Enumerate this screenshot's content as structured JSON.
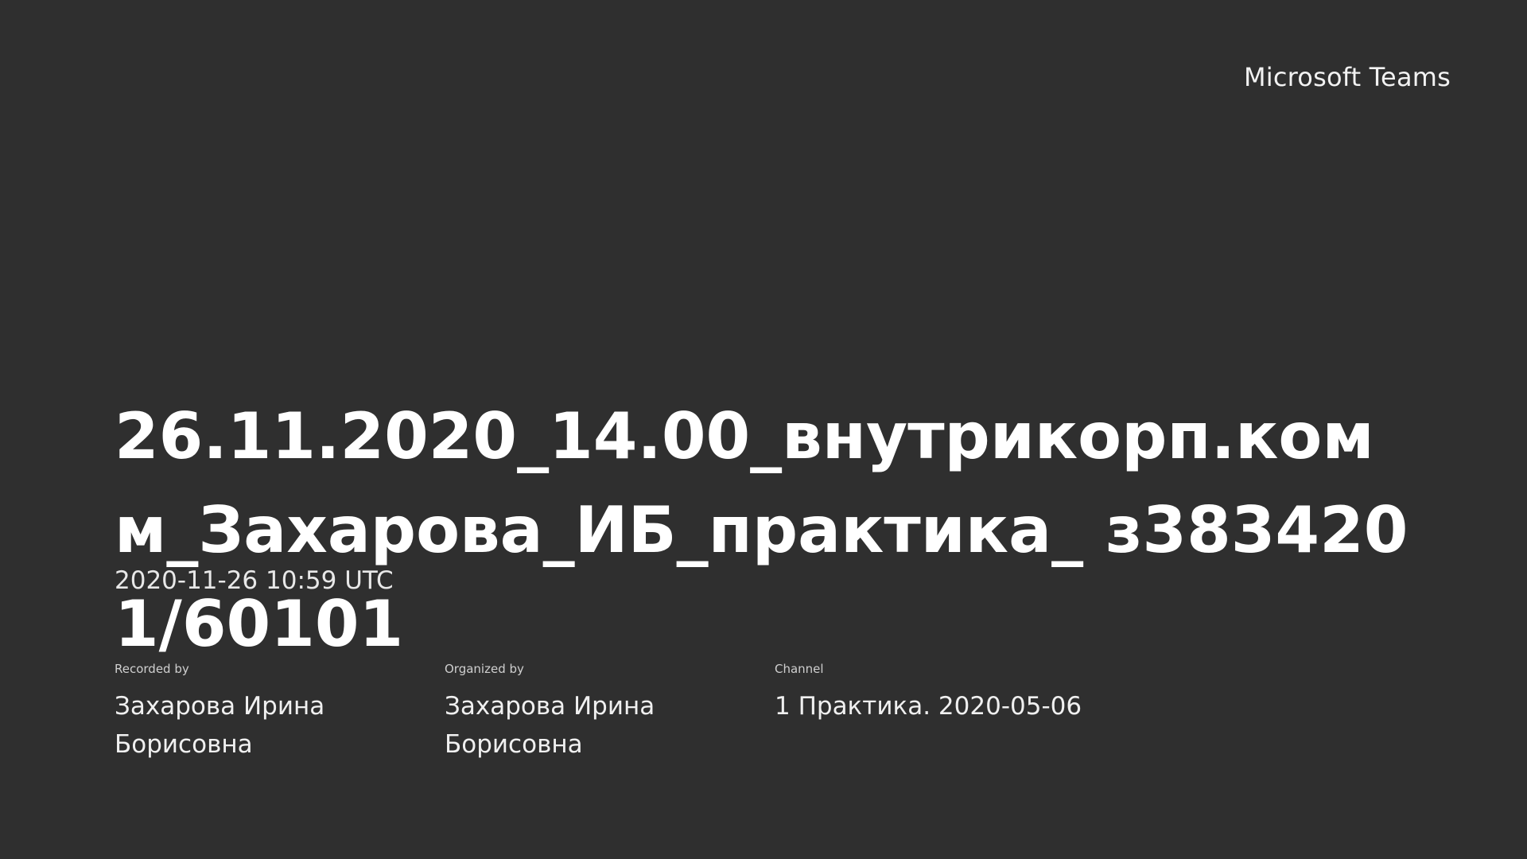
{
  "brand": "Microsoft Teams",
  "recording": {
    "title": "26.11.2020_14.00_внутрикорп.комм_Захарова_ИБ_практика_ з3834201/60101",
    "datetime": "2020-11-26 10:59 UTC"
  },
  "meta": {
    "recorded_by_label": "Recorded by",
    "recorded_by": "Захарова Ирина Борисовна",
    "organized_by_label": "Organized by",
    "organized_by": "Захарова Ирина Борисовна",
    "channel_label": "Channel",
    "channel": "1 Практика. 2020-05-06"
  },
  "colors": {
    "background": "#2f2f2f",
    "text": "#ffffff"
  }
}
